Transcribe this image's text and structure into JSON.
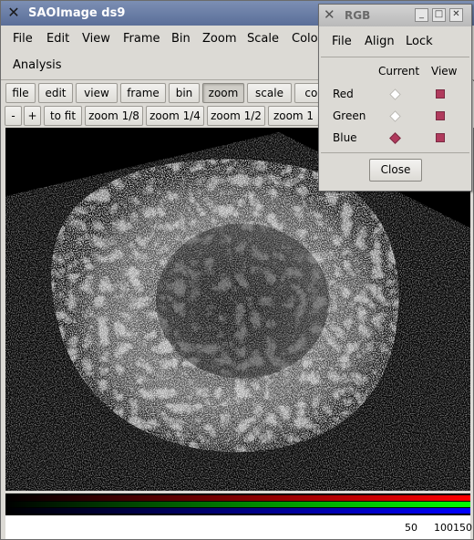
{
  "window": {
    "title": "SAOImage ds9"
  },
  "menu": {
    "items": [
      "File",
      "Edit",
      "View",
      "Frame",
      "Bin",
      "Zoom",
      "Scale",
      "Color"
    ],
    "row2": [
      "Analysis"
    ]
  },
  "button_bar": {
    "tabs": [
      "file",
      "edit",
      "view",
      "frame",
      "bin",
      "zoom",
      "scale",
      "col"
    ],
    "active": "zoom"
  },
  "zoom_bar": {
    "buttons": [
      "-",
      "+",
      "to fit",
      "zoom 1/8",
      "zoom 1/4",
      "zoom 1/2",
      "zoom 1"
    ]
  },
  "colorbar": {
    "tick_labels": [
      "50",
      "100150"
    ],
    "colors": {
      "red": "#ff0000",
      "green": "#00ff00",
      "blue": "#0000ff"
    }
  },
  "rgb_dialog": {
    "title": "RGB",
    "menu": [
      "File",
      "Align",
      "Lock"
    ],
    "headers": {
      "current": "Current",
      "view": "View"
    },
    "channels": [
      {
        "name": "Red",
        "current": false,
        "view": true
      },
      {
        "name": "Green",
        "current": false,
        "view": true
      },
      {
        "name": "Blue",
        "current": true,
        "view": true
      }
    ],
    "close_label": "Close",
    "accent": "#b03a5c"
  }
}
